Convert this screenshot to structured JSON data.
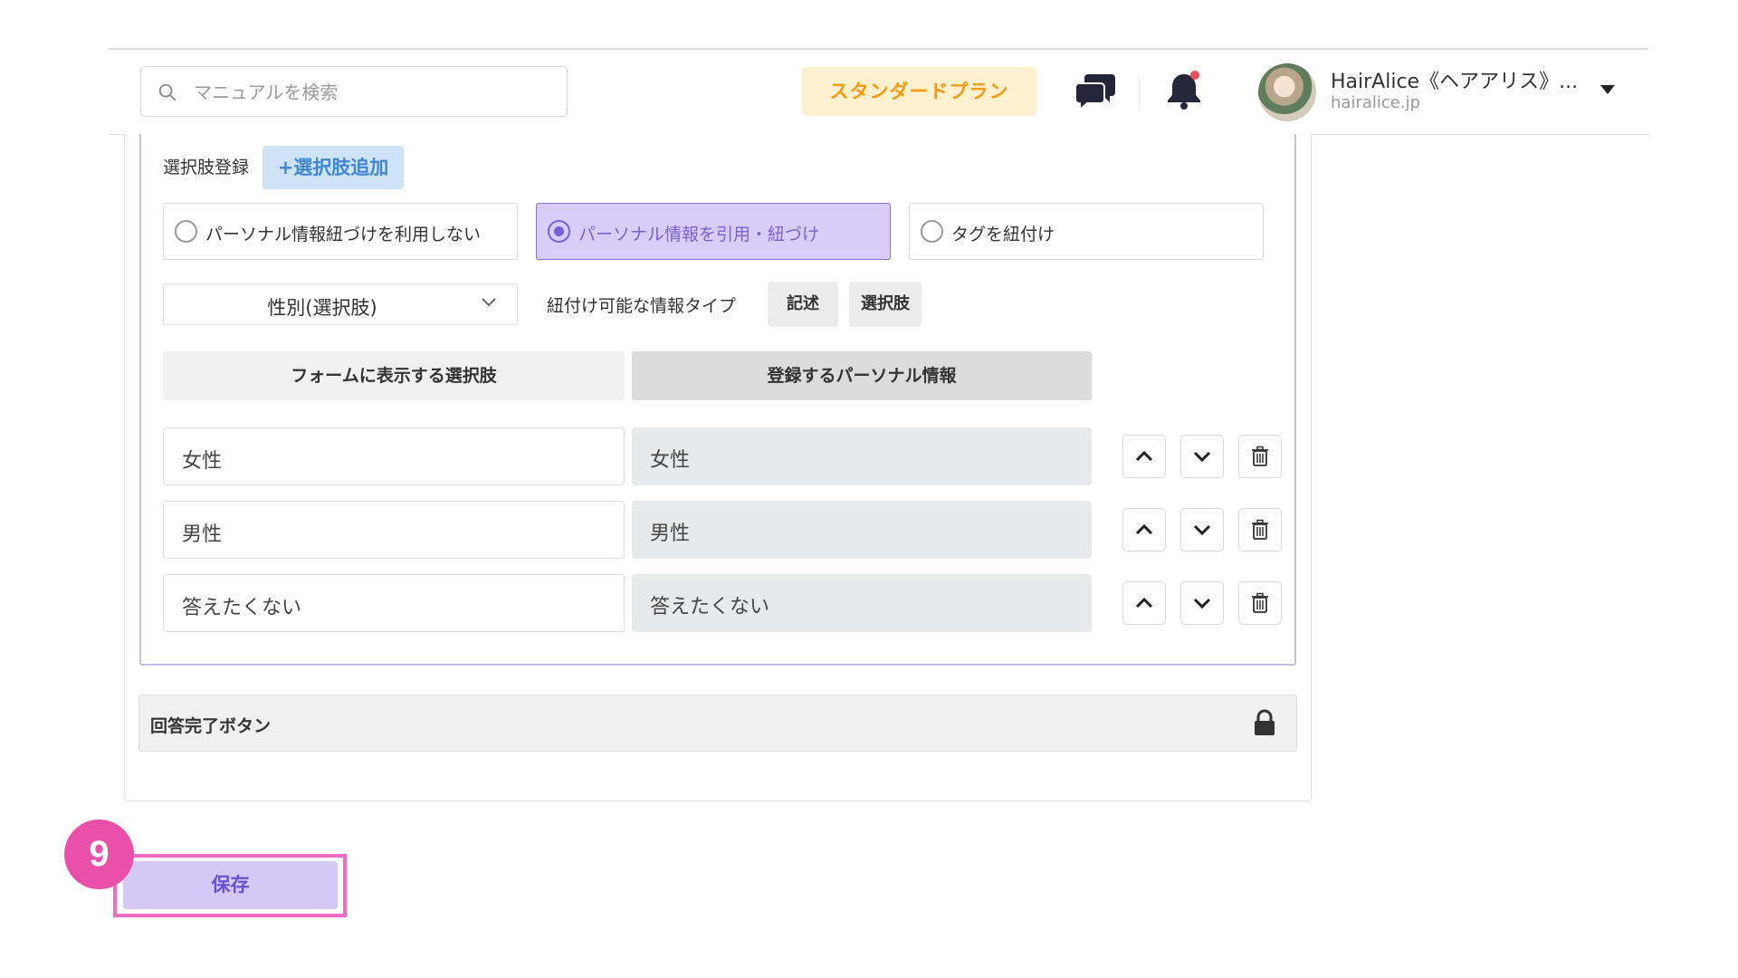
{
  "header": {
    "search_placeholder": "マニュアルを検索",
    "plan_label": "スタンダードプラン",
    "org_name": "HairAlice《ヘアアリス》...",
    "org_domain": "hairalice.jp"
  },
  "options_section": {
    "register_label": "選択肢登録",
    "add_button": "+選択肢追加",
    "link_modes": [
      {
        "label": "パーソナル情報紐づけを利用しない",
        "selected": false
      },
      {
        "label": "パーソナル情報を引用・紐づけ",
        "selected": true
      },
      {
        "label": "タグを紐付け",
        "selected": false
      }
    ],
    "info_select_value": "性別(選択肢)",
    "linkable_types_label": "紐付け可能な情報タイプ",
    "linkable_types": [
      "記述",
      "選択肢"
    ],
    "columns": {
      "form_options": "フォームに表示する選択肢",
      "personal_info": "登録するパーソナル情報"
    },
    "rows": [
      {
        "form_value": "女性",
        "personal_value": "女性"
      },
      {
        "form_value": "男性",
        "personal_value": "男性"
      },
      {
        "form_value": "答えたくない",
        "personal_value": "答えたくない"
      }
    ]
  },
  "complete_section": {
    "label": "回答完了ボタン"
  },
  "save_button": "保存",
  "step_badge": "9",
  "colors": {
    "accent_purple": "#7b5fd6",
    "plan_orange": "#f39a11",
    "highlight_pink": "#f06bc5"
  }
}
